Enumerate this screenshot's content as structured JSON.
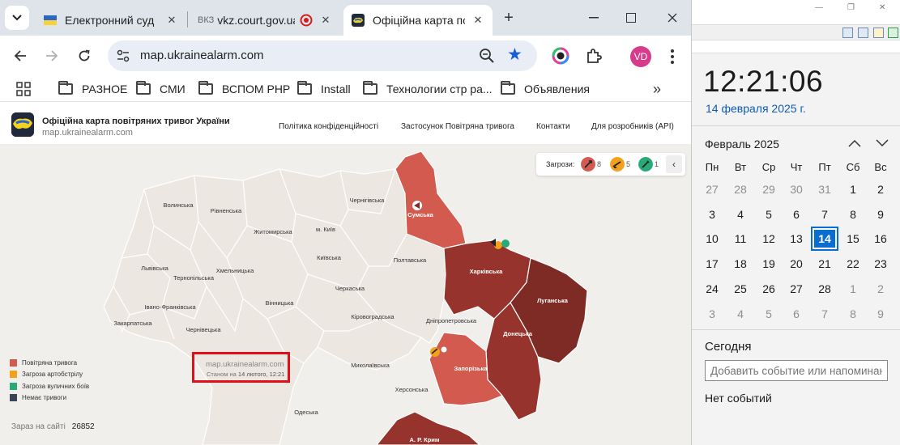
{
  "browser": {
    "tabs": [
      {
        "title": "Електронний суд",
        "active": false,
        "favicon": "ukraine-flag-icon"
      },
      {
        "title": "vkz.court.gov.ua",
        "prefix": "ВКЗ",
        "active": false,
        "favicon": "record-icon"
      },
      {
        "title": "Офіційна карта по",
        "active": true,
        "favicon": "ukrainealarm-logo-icon"
      }
    ],
    "url": "map.ukrainealarm.com",
    "profile_initials": "VD",
    "bookmarks": [
      "РАЗНОЕ",
      "СМИ",
      "ВСПОМ РНР",
      "Install",
      "Технологии стр ра...",
      "Объявления"
    ],
    "bookmarks_more": "»"
  },
  "site": {
    "title": "Офіційна карта повітряних тривог України",
    "url": "map.ukrainealarm.com",
    "nav": [
      "Політика конфіденційності",
      "Застосунок Повітряна тривога",
      "Контакти",
      "Для розробників (API)"
    ]
  },
  "threats": {
    "label": "Загрози:",
    "items": [
      {
        "count": "8",
        "color": "#d25a4e"
      },
      {
        "count": "5",
        "color": "#f3a11c"
      },
      {
        "count": "1",
        "color": "#27a978"
      }
    ],
    "collapse": "‹"
  },
  "regions": {
    "volynska": "Волинська",
    "rivnenska": "Рівненська",
    "zhytomyrska": "Житомирська",
    "chernihivska": "Чернігівська",
    "sumska": "Сумська",
    "kyiv": "м. Київ",
    "kyivska": "Київська",
    "lvivska": "Львівська",
    "ternopilska": "Тернопільська",
    "khmelnytska": "Хмельницька",
    "poltavska": "Полтавська",
    "kharkivska": "Харківська",
    "luhanska": "Луганська",
    "ivano_frankivska": "Івано-Франківська",
    "vinnytska": "Вінницька",
    "cherkaska": "Черкаська",
    "zakarpatska": "Закарпатська",
    "chernivetska": "Чернівецька",
    "kirovohradska": "Кіровоградська",
    "dnipropetrovska": "Дніпропетровська",
    "donetska": "Донецька",
    "zaporizka": "Запорізька",
    "mykolaivska": "Миколаївська",
    "khersonska": "Херсонська",
    "odeska": "Одеська",
    "crimea": "А. Р. Крим"
  },
  "legend": [
    {
      "label": "Повітряна тривога",
      "color": "#d25a4e"
    },
    {
      "label": "Загроза артобстрілу",
      "color": "#f3a11c"
    },
    {
      "label": "Загроза вуличних боїв",
      "color": "#27a978"
    },
    {
      "label": "Немає тривоги",
      "color": "#3a4454"
    }
  ],
  "watermark": {
    "url": "map.ukrainealarm.com",
    "as_of": "Станом на",
    "time": "14 лютого, 12:21"
  },
  "online": {
    "label": "Зараз на сайті",
    "count": "26852"
  },
  "colors": {
    "alarm": "#d25a4e",
    "alarm_dark": "#7e2b25",
    "alarm_mid": "#96332c",
    "land": "#ece7e1",
    "accent": "#0a6ed0"
  },
  "calendar": {
    "time": "12:21:06",
    "date": "14 февраля 2025 г.",
    "month": "Февраль 2025",
    "weekdays": [
      "Пн",
      "Вт",
      "Ср",
      "Чт",
      "Пт",
      "Сб",
      "Вс"
    ],
    "days": [
      [
        "27",
        "28",
        "29",
        "30",
        "31",
        "1",
        "2"
      ],
      [
        "3",
        "4",
        "5",
        "6",
        "7",
        "8",
        "9"
      ],
      [
        "10",
        "11",
        "12",
        "13",
        "14",
        "15",
        "16"
      ],
      [
        "17",
        "18",
        "19",
        "20",
        "21",
        "22",
        "23"
      ],
      [
        "24",
        "25",
        "26",
        "27",
        "28",
        "1",
        "2"
      ],
      [
        "3",
        "4",
        "5",
        "6",
        "7",
        "8",
        "9"
      ]
    ],
    "today": "14",
    "today_title": "Сегодня",
    "event_placeholder": "Добавить событие или напоминание",
    "no_events": "Нет событий"
  }
}
